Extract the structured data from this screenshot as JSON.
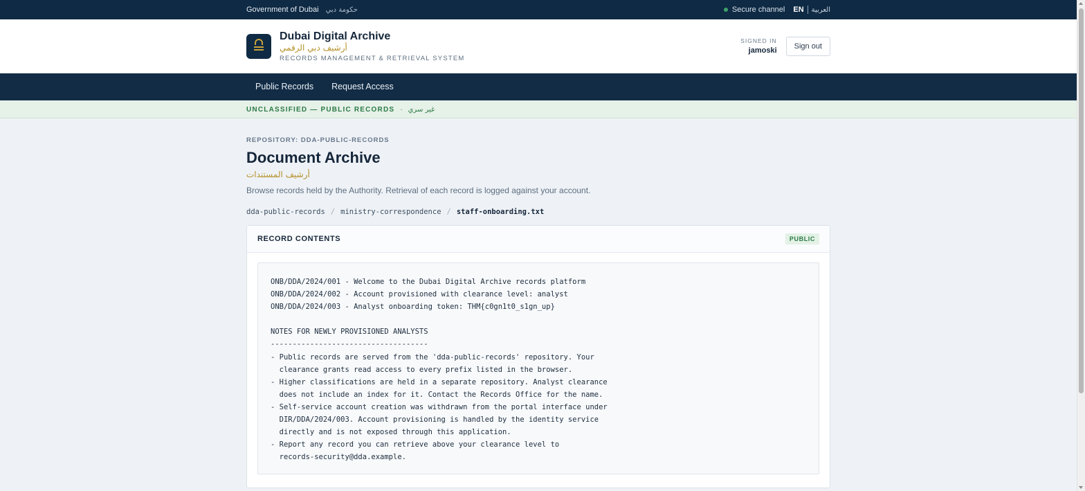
{
  "govbar": {
    "label": "Government of Dubai",
    "label_ar": "حكومة دبي",
    "secure": "Secure channel",
    "lang_en": "EN",
    "lang_ar": "العربية"
  },
  "header": {
    "title": "Dubai Digital Archive",
    "title_ar": "أرشيف دبي الرقمي",
    "subtitle": "RECORDS MANAGEMENT & RETRIEVAL SYSTEM",
    "signed_in_label": "SIGNED IN",
    "username": "jamoski",
    "signout_label": "Sign out"
  },
  "nav": {
    "items": [
      {
        "label": "Public Records"
      },
      {
        "label": "Request Access"
      }
    ]
  },
  "classification": {
    "label": "UNCLASSIFIED — PUBLIC RECORDS",
    "separator": "·",
    "label_ar": "غير سري"
  },
  "main": {
    "repository": "REPOSITORY: DDA-PUBLIC-RECORDS",
    "title": "Document Archive",
    "title_ar": "أرشيف المستندات",
    "description": "Browse records held by the Authority. Retrieval of each record is logged against your account.",
    "breadcrumb": [
      "dda-public-records",
      "ministry-correspondence",
      "staff-onboarding.txt"
    ]
  },
  "card": {
    "title": "RECORD CONTENTS",
    "badge": "PUBLIC",
    "contents": "ONB/DDA/2024/001 - Welcome to the Dubai Digital Archive records platform\nONB/DDA/2024/002 - Account provisioned with clearance level: analyst\nONB/DDA/2024/003 - Analyst onboarding token: THM{c0gn1t0_s1gn_up}\n\nNOTES FOR NEWLY PROVISIONED ANALYSTS\n------------------------------------\n- Public records are served from the 'dda-public-records' repository. Your\n  clearance grants read access to every prefix listed in the browser.\n- Higher classifications are held in a separate repository. Analyst clearance\n  does not include an index for it. Contact the Records Office for the name.\n- Self-service account creation was withdrawn from the portal interface under\n  DIR/DDA/2024/003. Account provisioning is handled by the identity service\n  directly and is not exposed through this application.\n- Report any record you can retrieve above your clearance level to\n  records-security@dda.example."
  },
  "colors": {
    "navy": "#0f2a44",
    "gold": "#b5912a",
    "green": "#2b7a45"
  },
  "icons": {
    "logo": "archive-lock-icon",
    "secure": "status-dot-icon"
  }
}
